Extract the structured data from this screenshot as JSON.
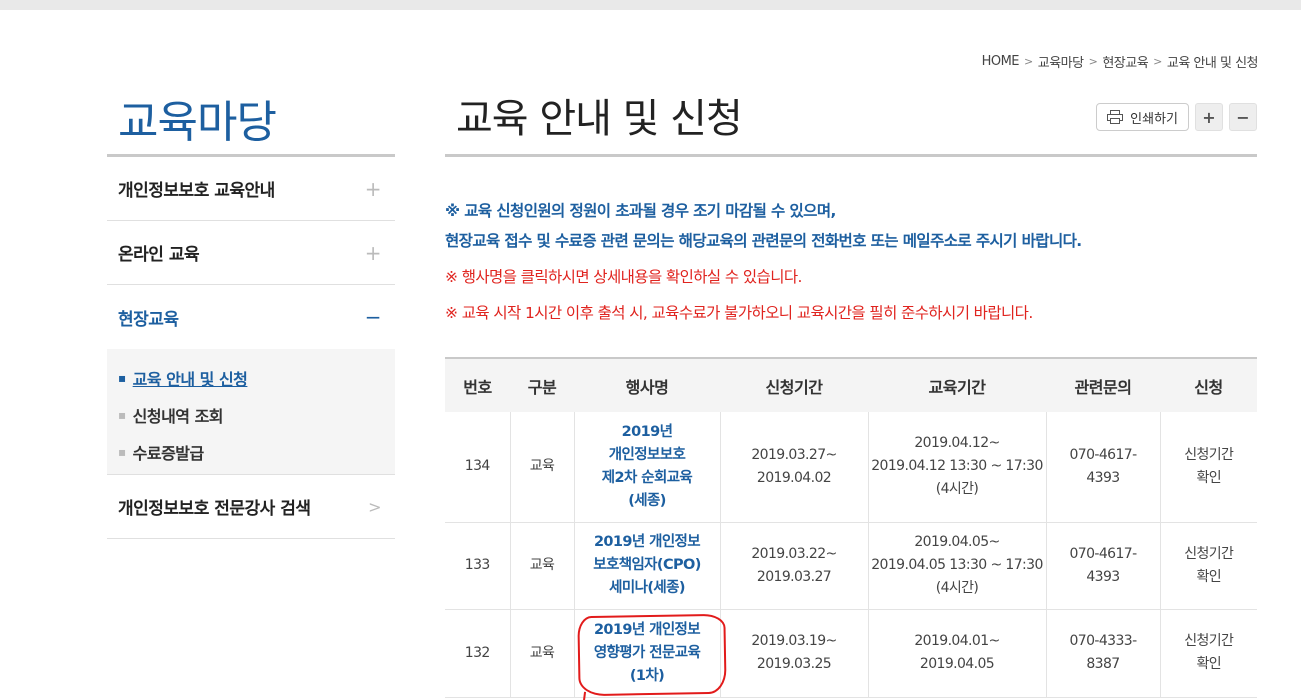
{
  "breadcrumb": [
    "HOME",
    "교육마당",
    "현장교육",
    "교육 안내 및 신청"
  ],
  "sidebar": {
    "title": "교육마당",
    "items": [
      {
        "label": "개인정보보호 교육안내",
        "icon": "plus-icon"
      },
      {
        "label": "온라인 교육",
        "icon": "plus-icon"
      },
      {
        "label": "현장교육",
        "icon": "minus-icon",
        "active": true
      },
      {
        "label": "개인정보보호 전문강사 검색",
        "icon": "chevron-right-icon"
      }
    ],
    "submenu": [
      {
        "label": "교육 안내 및 신청",
        "current": true
      },
      {
        "label": "신청내역 조회"
      },
      {
        "label": "수료증발급"
      }
    ]
  },
  "page": {
    "title": "교육 안내 및 신청",
    "print_label": "인쇄하기",
    "zoom_in": "+",
    "zoom_out": "−"
  },
  "notices": {
    "blue_line1": "※ 교육 신청인원의 정원이 초과될 경우 조기 마감될 수 있으며,",
    "blue_line2": "현장교육 접수 및 수료증 관련 문의는 해당교육의 관련문의 전화번호 또는 메일주소로 주시기 바랍니다.",
    "red_line1": "※ 행사명을 클릭하시면 상세내용을 확인하실 수 있습니다.",
    "red_line2": "※ 교육 시작 1시간 이후 출석 시, 교육수료가 불가하오니 교육시간을 필히 준수하시기 바랍니다."
  },
  "table": {
    "headers": [
      "번호",
      "구분",
      "행사명",
      "신청기간",
      "교육기간",
      "관련문의",
      "신청"
    ],
    "rows": [
      {
        "no": "134",
        "type": "교육",
        "event": [
          "2019년",
          "개인정보보호",
          "제2차 순회교육",
          "(세종)"
        ],
        "apply": [
          "2019.03.27~",
          "2019.04.02"
        ],
        "period": [
          "2019.04.12~",
          "2019.04.12 13:30 ~ 17:30",
          "(4시간)"
        ],
        "contact": [
          "070-4617-",
          "4393"
        ],
        "status": [
          "신청기간",
          "확인"
        ]
      },
      {
        "no": "133",
        "type": "교육",
        "event": [
          "2019년 개인정보",
          "보호책임자(CPO)",
          "세미나(세종)"
        ],
        "apply": [
          "2019.03.22~",
          "2019.03.27"
        ],
        "period": [
          "2019.04.05~",
          "2019.04.05 13:30 ~ 17:30",
          "(4시간)"
        ],
        "contact": [
          "070-4617-",
          "4393"
        ],
        "status": [
          "신청기간",
          "확인"
        ]
      },
      {
        "no": "132",
        "type": "교육",
        "event": [
          "2019년 개인정보",
          "영향평가 전문교육",
          "(1차)"
        ],
        "apply": [
          "2019.03.19~",
          "2019.03.25"
        ],
        "period": [
          "2019.04.01~",
          "2019.04.05"
        ],
        "contact": [
          "070-4333-",
          "8387"
        ],
        "status": [
          "신청기간",
          "확인"
        ]
      }
    ]
  },
  "colors": {
    "accent_blue": "#1d5fa0",
    "notice_red": "#e0241f",
    "annotation_red": "#e21b1b"
  }
}
